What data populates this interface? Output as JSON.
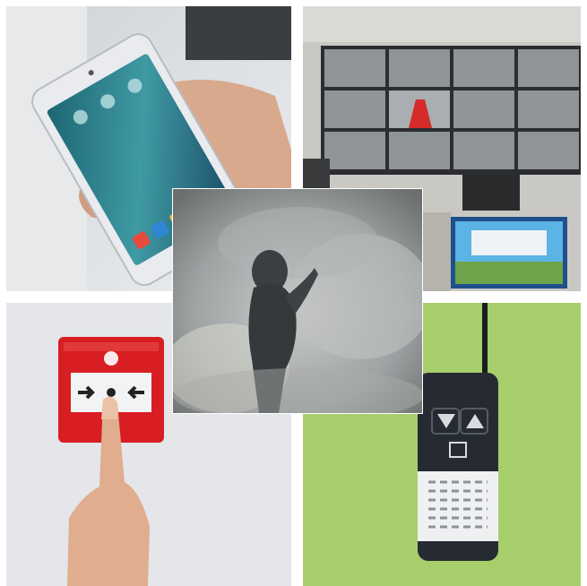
{
  "collage": {
    "panels": [
      {
        "id": "phone",
        "subject": "smartphone-app-control",
        "bg": "#d9dde3"
      },
      {
        "id": "monitor",
        "subject": "cctv-video-wall",
        "bg": "#c9c7c2"
      },
      {
        "id": "smoke",
        "subject": "fog-security-smoke",
        "bg": "#9ea3a4"
      },
      {
        "id": "call-point",
        "subject": "red-manual-call-point",
        "bg": "#e5e7ea"
      },
      {
        "id": "remote",
        "subject": "wireless-remote-control",
        "bg": "#a8ce6c"
      }
    ]
  },
  "colors": {
    "call_point_red": "#d81e22",
    "remote_green_bg": "#a8ce6c",
    "remote_body": "#262b33",
    "phone_screen": "#2f7f8e",
    "smoke_grey": "#a6aaab"
  },
  "icons": [
    "smartphone-icon",
    "video-wall-icon",
    "person-silhouette-icon",
    "alarm-button-icon",
    "remote-antenna-icon"
  ]
}
